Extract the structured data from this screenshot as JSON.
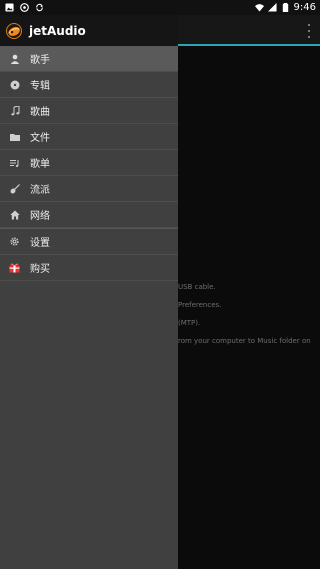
{
  "status_bar": {
    "time": "9:46",
    "left_icons": [
      "image-icon",
      "circle-icon",
      "sync-icon"
    ],
    "right_icons": [
      "wifi-icon",
      "signal-icon",
      "battery-icon"
    ]
  },
  "drawer": {
    "app_title": "jetAudio",
    "items": [
      {
        "label": "歌手",
        "icon": "person-icon",
        "active": true
      },
      {
        "label": "专辑",
        "icon": "disc-icon",
        "active": false
      },
      {
        "label": "歌曲",
        "icon": "music-note-icon",
        "active": false
      },
      {
        "label": "文件",
        "icon": "folder-icon",
        "active": false
      },
      {
        "label": "歌单",
        "icon": "playlist-icon",
        "active": false
      },
      {
        "label": "流派",
        "icon": "guitar-icon",
        "active": false
      },
      {
        "label": "网络",
        "icon": "network-icon",
        "active": false
      },
      {
        "label": "设置",
        "icon": "gear-icon",
        "active": false
      },
      {
        "label": "购买",
        "icon": "gift-icon",
        "active": false
      }
    ]
  },
  "background": {
    "lines": [
      "USB cable.",
      "Preferences.",
      "(MTP).",
      "rom your computer to Music folder on"
    ]
  },
  "colors": {
    "accent": "#2aa6b3",
    "drawer_bg": "#404040",
    "header_bg": "#151515",
    "active_item_bg": "#5a5a5a"
  }
}
